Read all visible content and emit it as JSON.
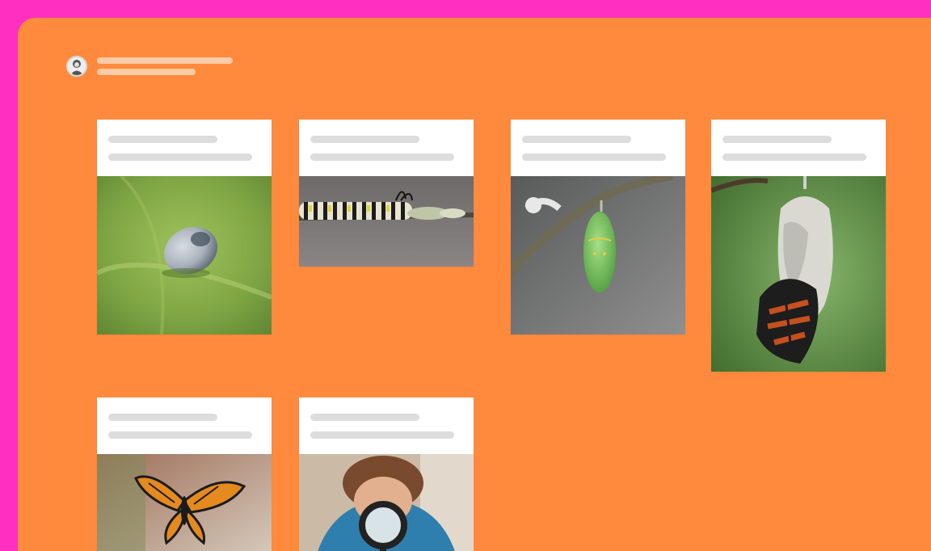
{
  "colors": {
    "outer_background": "#ff2fc1",
    "canvas_background": "#ff8a3d",
    "card_background": "#ffffff",
    "placeholder_bar": "#dddddd"
  },
  "header": {
    "avatar_icon": "user-avatar-icon"
  },
  "cards": [
    {
      "image": "butterfly-egg-on-leaf"
    },
    {
      "image": "caterpillar-on-stem"
    },
    {
      "image": "green-chrysalis"
    },
    {
      "image": "butterfly-emerging-from-chrysalis"
    },
    {
      "image": "monarch-butterfly"
    },
    {
      "image": "child-with-magnifying-glass"
    }
  ]
}
